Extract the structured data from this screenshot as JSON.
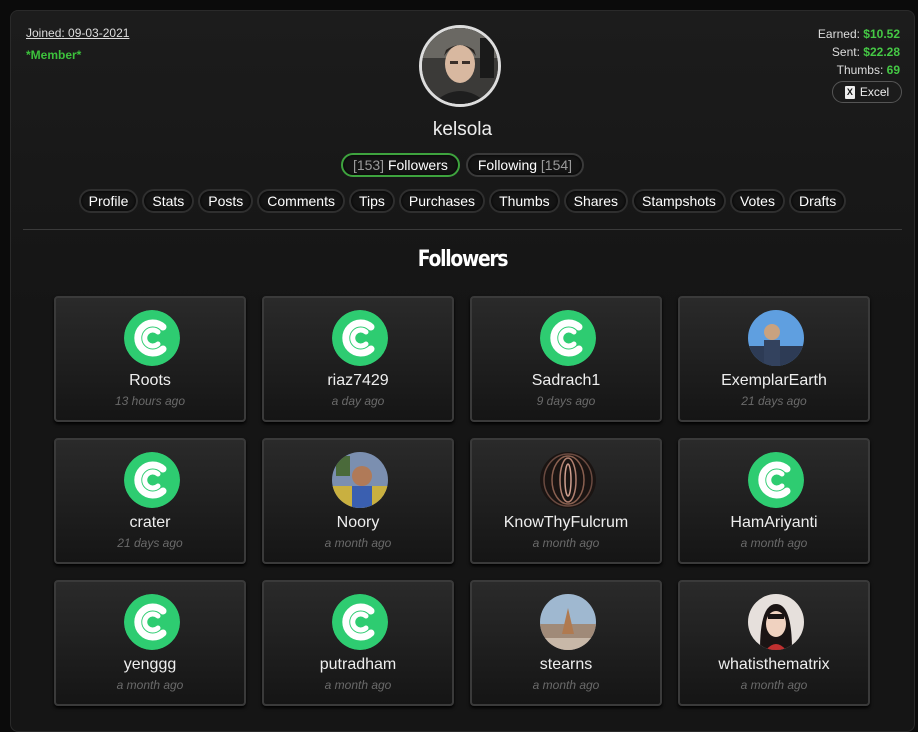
{
  "profile": {
    "joined": "Joined: 09-03-2021",
    "role": "*Member*",
    "username": "kelsola",
    "earned_label": "Earned:",
    "earned_value": "$10.52",
    "sent_label": "Sent:",
    "sent_value": "$22.28",
    "thumbs_label": "Thumbs:",
    "thumbs_value": "69",
    "excel_label": "Excel"
  },
  "follow_tabs": {
    "followers_count": "[153]",
    "followers_label": "Followers",
    "following_label": "Following",
    "following_count": "[154]"
  },
  "nav": [
    "Profile",
    "Stats",
    "Posts",
    "Comments",
    "Tips",
    "Purchases",
    "Thumbs",
    "Shares",
    "Stampshots",
    "Votes",
    "Drafts"
  ],
  "section_title": "Followers",
  "followers": [
    {
      "name": "Roots",
      "time": "13 hours ago",
      "avatar": "logo"
    },
    {
      "name": "riaz7429",
      "time": "a day ago",
      "avatar": "logo"
    },
    {
      "name": "Sadrach1",
      "time": "9 days ago",
      "avatar": "logo"
    },
    {
      "name": "ExemplarEarth",
      "time": "21 days ago",
      "avatar": "photo-sky"
    },
    {
      "name": "crater",
      "time": "21 days ago",
      "avatar": "logo"
    },
    {
      "name": "Noory",
      "time": "a month ago",
      "avatar": "photo-child"
    },
    {
      "name": "KnowThyFulcrum",
      "time": "a month ago",
      "avatar": "photo-rings"
    },
    {
      "name": "HamAriyanti",
      "time": "a month ago",
      "avatar": "logo"
    },
    {
      "name": "yenggg",
      "time": "a month ago",
      "avatar": "logo"
    },
    {
      "name": "putradham",
      "time": "a month ago",
      "avatar": "logo"
    },
    {
      "name": "stearns",
      "time": "a month ago",
      "avatar": "photo-beach"
    },
    {
      "name": "whatisthematrix",
      "time": "a month ago",
      "avatar": "photo-person"
    }
  ],
  "colors": {
    "accent_green": "#45c845",
    "logo_green": "#2ecc71"
  }
}
